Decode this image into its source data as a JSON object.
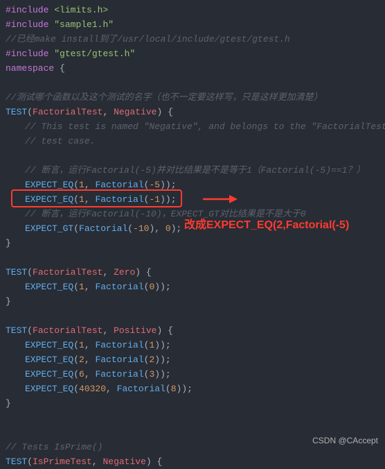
{
  "lines": {
    "l1_kw": "#include",
    "l1_inc": "<limits.h>",
    "l2_kw": "#include",
    "l2_inc": "\"sample1.h\"",
    "l3_comment": "//已经make install到了/usr/local/include/gtest/gtest.h",
    "l4_kw": "#include",
    "l4_inc": "\"gtest/gtest.h\"",
    "l5_kw": "namespace",
    "l5_brace": " {",
    "l7_comment": "//测试哪个函数以及这个测试的名字（也不一定要这样写，只是这样更加清楚）",
    "l8_test": "TEST",
    "l8_a": "FactorialTest",
    "l8_b": "Negative",
    "l8_brace": ") {",
    "l9_comment": "// This test is named \"Negative\", and belongs to the \"FactorialTest\"",
    "l10_comment": "// test case.",
    "l12_comment": "// 断言，运行Factorial(-5)并对比结果是不是等于1（Factorial(-5)==1？）",
    "l13_macro": "EXPECT_EQ",
    "l13_n1": "1",
    "l13_fn": "Factorial",
    "l13_n2": "-5",
    "l14_macro": "EXPECT_EQ",
    "l14_n1": "1",
    "l14_fn": "Factorial",
    "l14_n2": "-1",
    "l15_comment": "// 断言，运行Factorial(-10)，EXPECT_GT对比结果是不是大于0",
    "l16_macro": "EXPECT_GT",
    "l16_fn": "Factorial",
    "l16_n1": "-10",
    "l16_n2": "0",
    "l17_brace": "}",
    "l19_test": "TEST",
    "l19_a": "FactorialTest",
    "l19_b": "Zero",
    "l19_brace": ") {",
    "l20_macro": "EXPECT_EQ",
    "l20_n1": "1",
    "l20_fn": "Factorial",
    "l20_n2": "0",
    "l21_brace": "}",
    "l23_test": "TEST",
    "l23_a": "FactorialTest",
    "l23_b": "Positive",
    "l23_brace": ") {",
    "l24_macro": "EXPECT_EQ",
    "l24_n1": "1",
    "l24_fn": "Factorial",
    "l24_n2": "1",
    "l25_macro": "EXPECT_EQ",
    "l25_n1": "2",
    "l25_fn": "Factorial",
    "l25_n2": "2",
    "l26_macro": "EXPECT_EQ",
    "l26_n1": "6",
    "l26_fn": "Factorial",
    "l26_n2": "3",
    "l27_macro": "EXPECT_EQ",
    "l27_n1": "40320",
    "l27_fn": "Factorial",
    "l27_n2": "8",
    "l28_brace": "}",
    "l31_comment": "// Tests IsPrime()",
    "l32_test": "TEST",
    "l32_a": "IsPrimeTest",
    "l32_b": "Negative",
    "l32_brace": ") {"
  },
  "annotation": "改成EXPECT_EQ(2,Factorial(-5)",
  "watermark": "CSDN @CAccept"
}
